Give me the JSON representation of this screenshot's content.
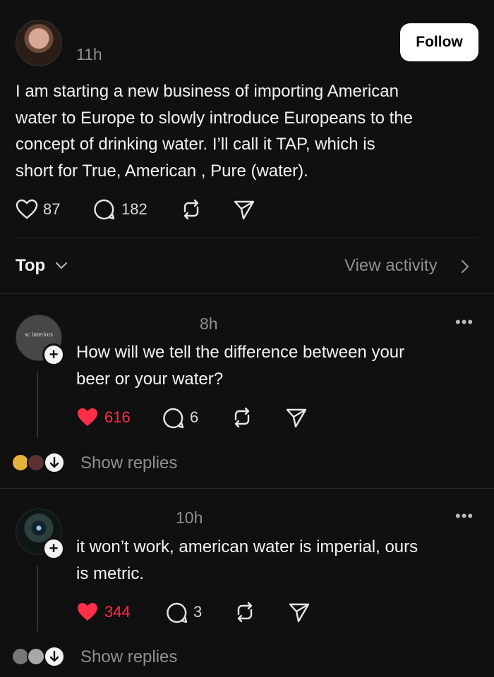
{
  "post": {
    "time": "11h",
    "follow_label": "Follow",
    "text_lines": [
      "I am starting a new business of importing American",
      "water to Europe to slowly introduce Europeans to the",
      "concept of drinking water. I’ll call it TAP, which is",
      "short for True, American , Pure (water)."
    ],
    "likes": "87",
    "comments": "182"
  },
  "sort": {
    "label": "Top",
    "view_activity": "View activity"
  },
  "replies": [
    {
      "time": "8h",
      "avatar_text": "sc interiors",
      "text_lines": [
        "How will we tell the difference between your",
        "beer or your water?"
      ],
      "likes": "616",
      "comments": "6",
      "show_replies": "Show replies"
    },
    {
      "time": "10h",
      "text_lines": [
        "it won’t work, american water is imperial, ours",
        "is metric."
      ],
      "likes": "344",
      "comments": "3",
      "show_replies": "Show replies"
    }
  ],
  "colors": {
    "background": "#101010",
    "like_red": "#ff2e47",
    "muted": "#8f8f8f"
  },
  "icons": [
    "heart-icon",
    "comment-icon",
    "repost-icon",
    "share-icon",
    "chevron-down-icon",
    "chevron-right-icon",
    "more-icon",
    "plus-icon",
    "arrow-down-icon"
  ]
}
